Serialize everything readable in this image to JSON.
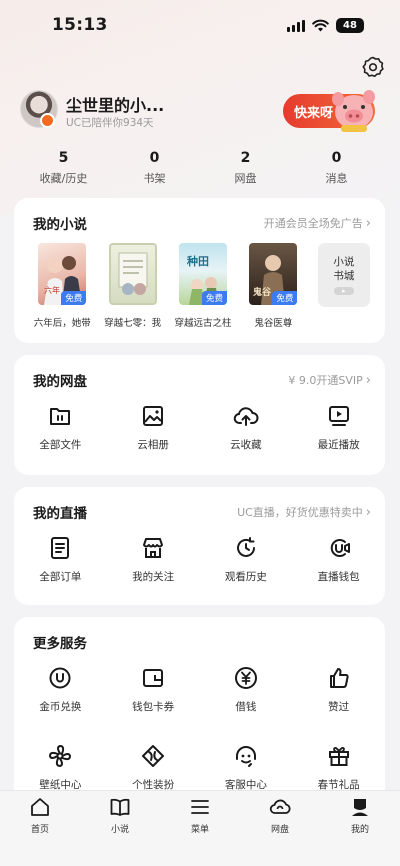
{
  "status_bar": {
    "time": "15:13",
    "battery": "48"
  },
  "profile": {
    "name": "尘世里的小...",
    "subtitle": "UC已陪伴你934天",
    "promo_label": "快来呀"
  },
  "stats": [
    {
      "value": "5",
      "label": "收藏/历史"
    },
    {
      "value": "0",
      "label": "书架"
    },
    {
      "value": "2",
      "label": "网盘"
    },
    {
      "value": "0",
      "label": "消息"
    }
  ],
  "novels": {
    "title": "我的小说",
    "link": "开通会员全场免广告",
    "items": [
      {
        "title": "六年后，她带",
        "tag": "免费",
        "cover_color": "#f4d8cf"
      },
      {
        "title": "穿越七零：我",
        "tag": "",
        "cover_color": "#dfe3cf"
      },
      {
        "title": "穿越远古之柱",
        "tag": "免费",
        "cover_color": "#cfe6ec"
      },
      {
        "title": "鬼谷医尊",
        "tag": "免费",
        "cover_color": "#3a2c22"
      }
    ],
    "bookstore_label": "小说书城"
  },
  "netdisk": {
    "title": "我的网盘",
    "link": "¥ 9.0开通SVIP",
    "items": [
      {
        "label": "全部文件",
        "icon": "folder-icon"
      },
      {
        "label": "云相册",
        "icon": "photo-icon"
      },
      {
        "label": "云收藏",
        "icon": "cloud-upload-icon"
      },
      {
        "label": "最近播放",
        "icon": "play-screen-icon"
      }
    ]
  },
  "live": {
    "title": "我的直播",
    "link": "UC直播，好货优惠特卖中",
    "items": [
      {
        "label": "全部订单",
        "icon": "order-icon"
      },
      {
        "label": "我的关注",
        "icon": "store-icon"
      },
      {
        "label": "观看历史",
        "icon": "history-icon"
      },
      {
        "label": "直播钱包",
        "icon": "wallet-video-icon"
      }
    ]
  },
  "more": {
    "title": "更多服务",
    "row1": [
      {
        "label": "金币兑换",
        "icon": "coin-icon"
      },
      {
        "label": "钱包卡券",
        "icon": "wallet-icon"
      },
      {
        "label": "借钱",
        "icon": "yuan-icon"
      },
      {
        "label": "赞过",
        "icon": "thumbs-up-icon"
      }
    ],
    "row2": [
      {
        "label": "壁纸中心",
        "icon": "pinwheel-icon"
      },
      {
        "label": "个性装扮",
        "icon": "style-icon"
      },
      {
        "label": "客服中心",
        "icon": "headset-icon"
      },
      {
        "label": "春节礼品",
        "icon": "gift-icon"
      }
    ]
  },
  "bottom_nav": [
    {
      "label": "首页",
      "icon": "home-icon"
    },
    {
      "label": "小说",
      "icon": "book-icon"
    },
    {
      "label": "菜单",
      "icon": "menu-icon"
    },
    {
      "label": "网盘",
      "icon": "cloud-icon"
    },
    {
      "label": "我的",
      "icon": "profile-icon"
    }
  ],
  "colors": {
    "accent": "#3c7bf1",
    "promo": "#e63b2e",
    "background": "#f3f3f5"
  }
}
